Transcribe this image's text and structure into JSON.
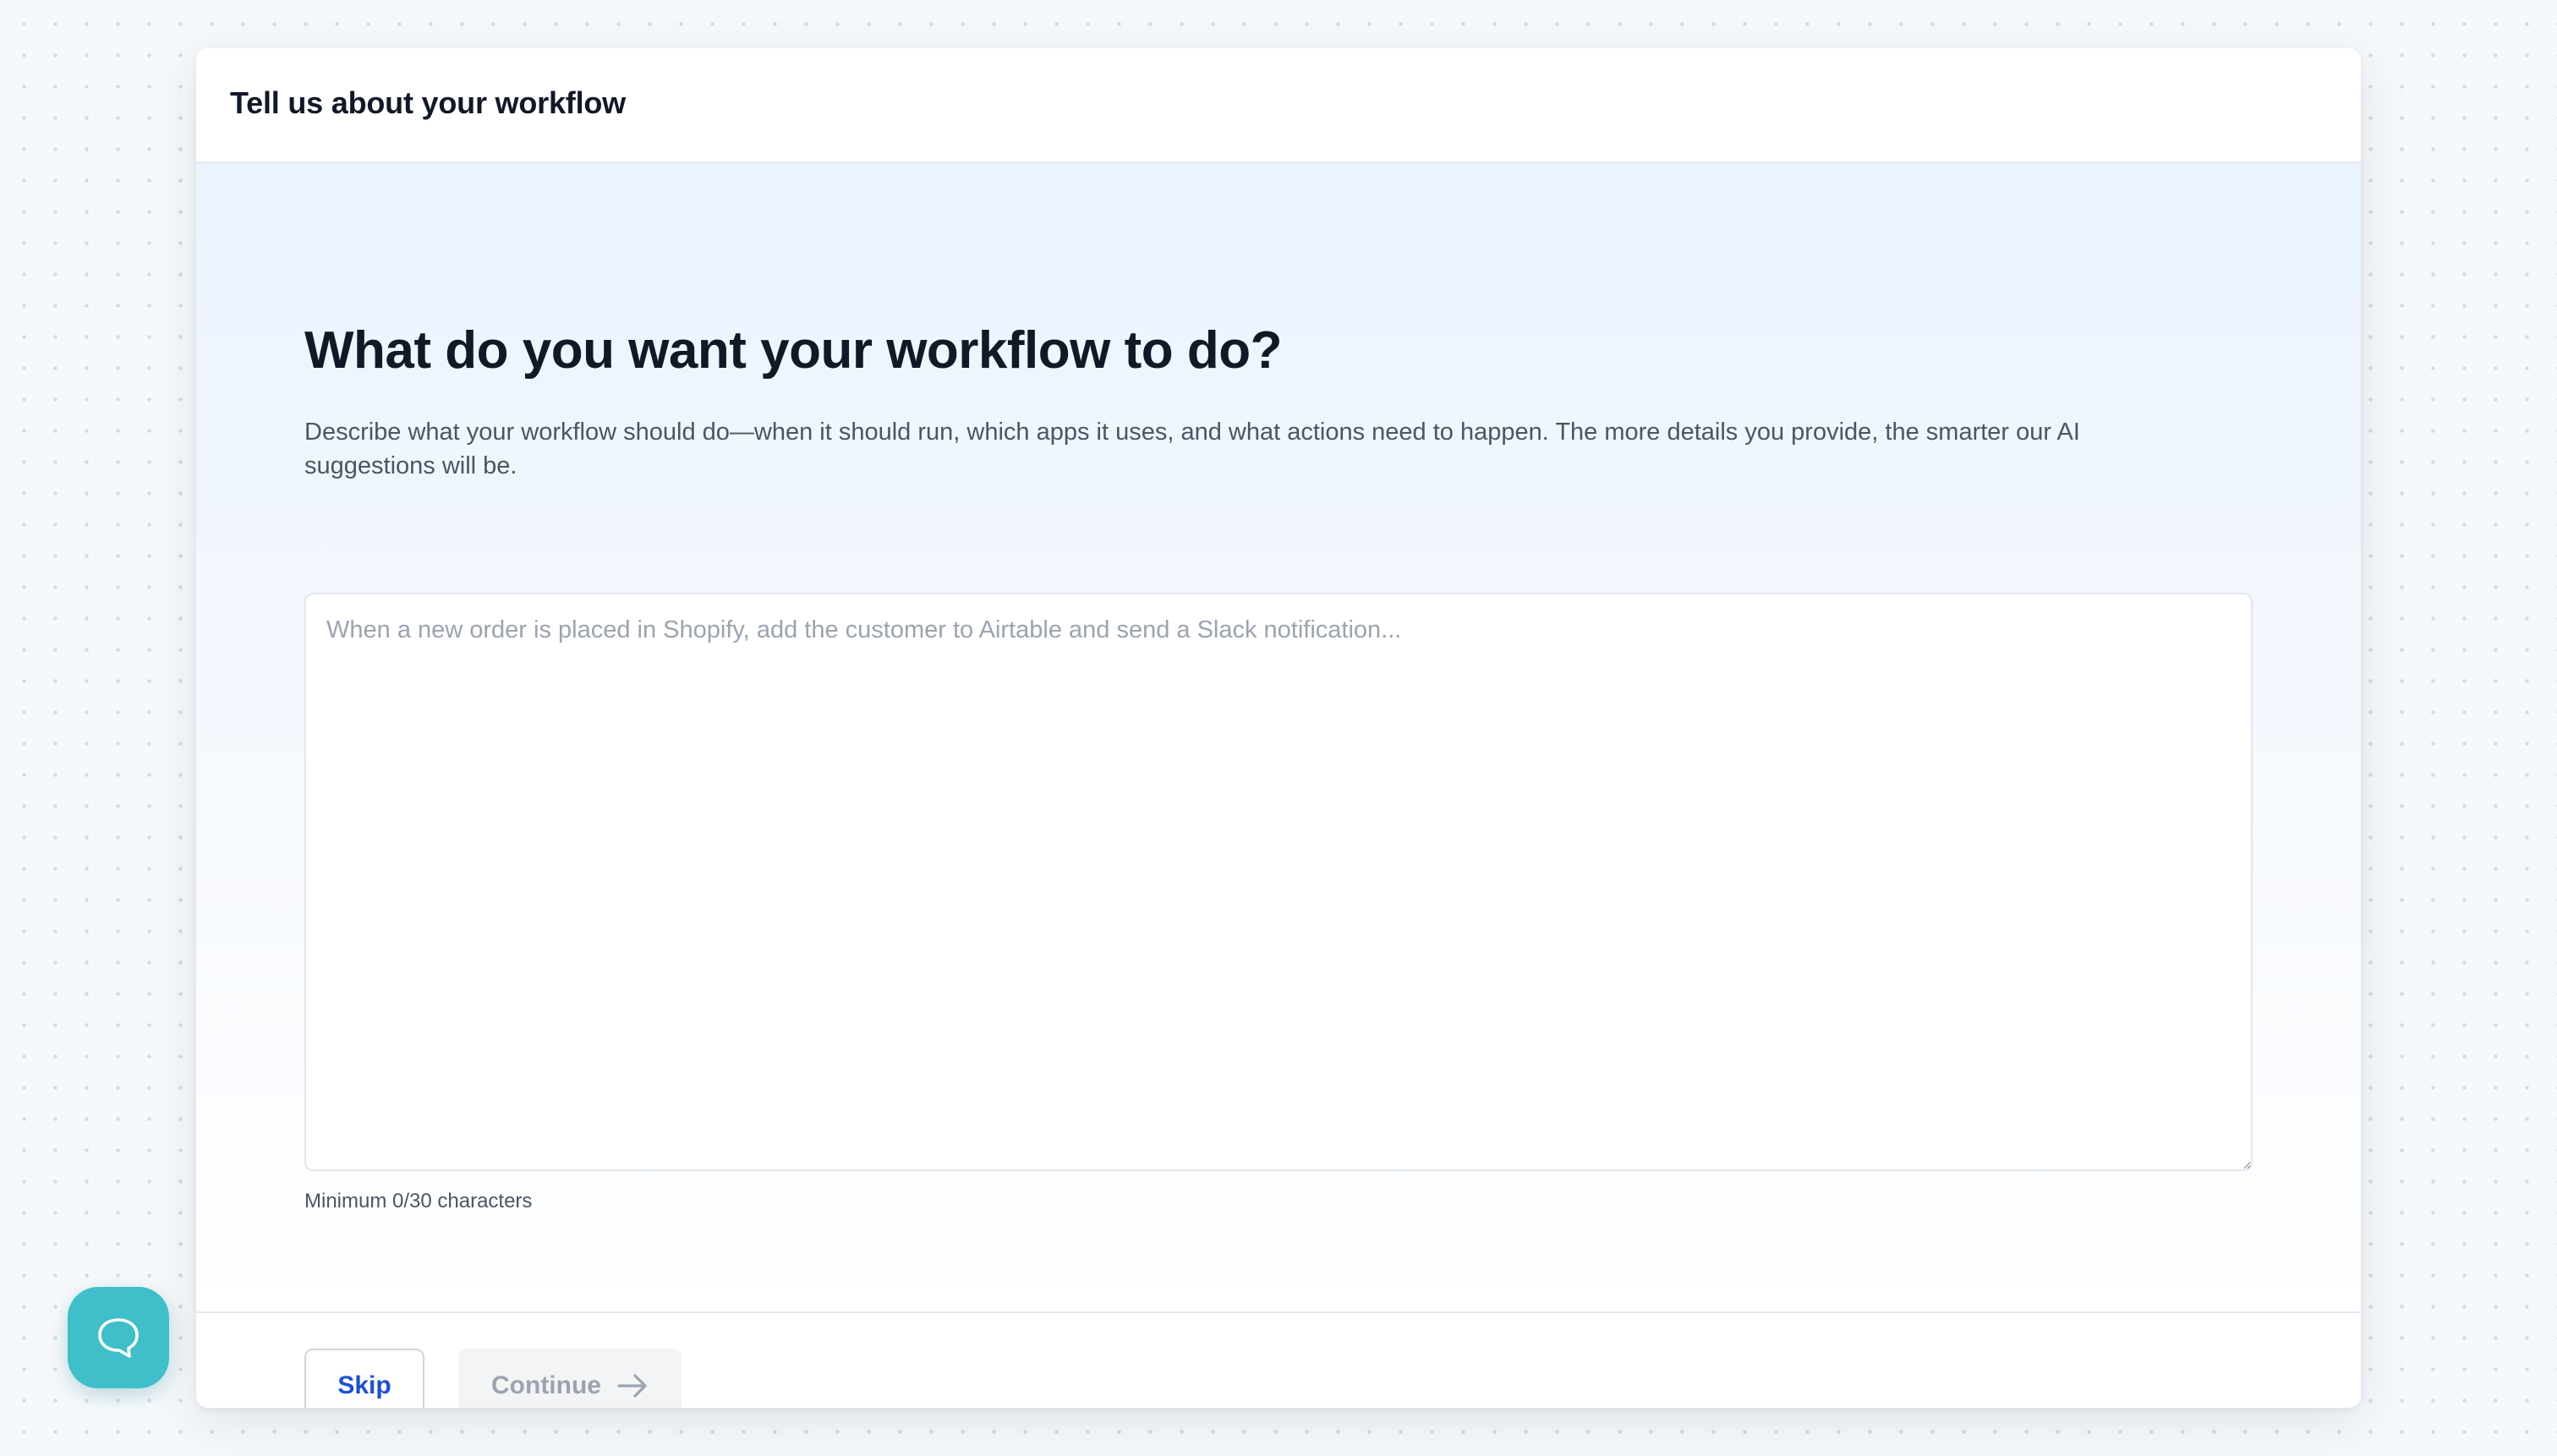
{
  "header": {
    "title": "Tell us about your workflow"
  },
  "main": {
    "question": "What do you want your workflow to do?",
    "description": "Describe what your workflow should do—when it should run, which apps it uses, and what actions need to happen. The more details you provide, the smarter our AI suggestions will be.",
    "textarea": {
      "value": "",
      "placeholder": "When a new order is placed in Shopify, add the customer to Airtable and send a Slack notification..."
    },
    "char_count": "Minimum 0/30 characters"
  },
  "footer": {
    "skip_label": "Skip",
    "continue_label": "Continue",
    "continue_icon": "arrow-right-icon",
    "continue_disabled": true
  },
  "chat_widget": {
    "icon": "chat-bubble-icon",
    "color": "#3ebfc9"
  },
  "colors": {
    "accent": "#1d4ed8",
    "heading": "#111827",
    "body_text": "#4b5563",
    "placeholder": "#9ca3af",
    "chat": "#3ebfc9"
  }
}
